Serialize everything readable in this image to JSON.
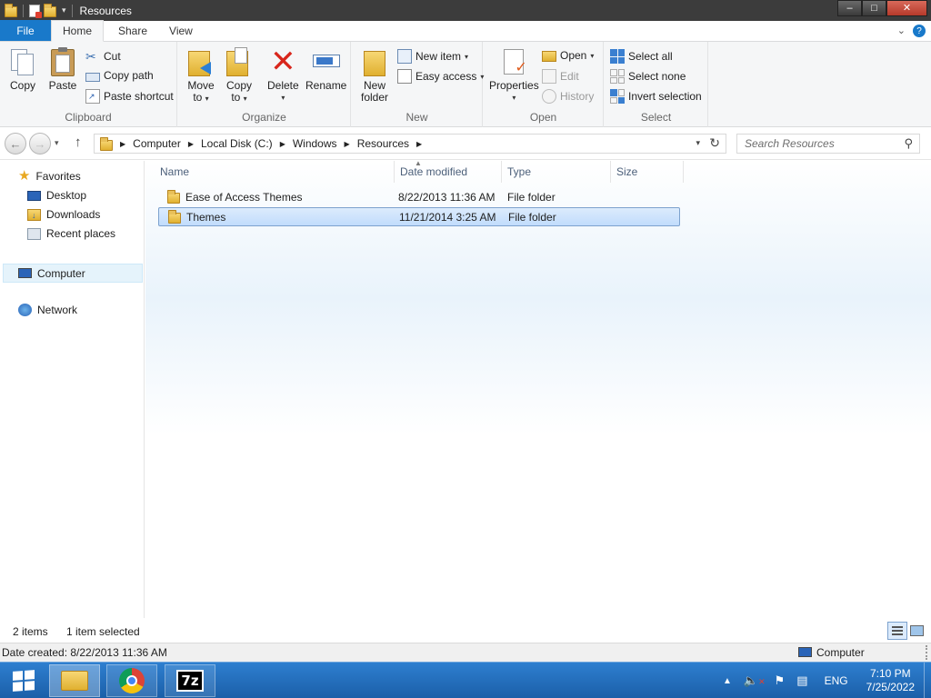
{
  "window": {
    "title": "Resources",
    "min_label": "–",
    "max_label": "□",
    "close_label": "✕"
  },
  "ribbon_tabs": {
    "file": "File",
    "home": "Home",
    "share": "Share",
    "view": "View"
  },
  "ribbon": {
    "clipboard": {
      "label": "Clipboard",
      "copy": "Copy",
      "paste": "Paste",
      "cut": "Cut",
      "copy_path": "Copy path",
      "paste_shortcut": "Paste shortcut"
    },
    "organize": {
      "label": "Organize",
      "move_to_1": "Move",
      "move_to_2": "to",
      "copy_to_1": "Copy",
      "copy_to_2": "to",
      "delete": "Delete",
      "rename": "Rename"
    },
    "new": {
      "label": "New",
      "new_folder_1": "New",
      "new_folder_2": "folder",
      "new_item": "New item",
      "easy_access": "Easy access"
    },
    "open": {
      "label": "Open",
      "properties": "Properties",
      "open": "Open",
      "edit": "Edit",
      "history": "History"
    },
    "select": {
      "label": "Select",
      "select_all": "Select all",
      "select_none": "Select none",
      "invert_selection": "Invert selection"
    }
  },
  "address": {
    "crumbs": [
      "Computer",
      "Local Disk (C:)",
      "Windows",
      "Resources"
    ],
    "search_placeholder": "Search Resources"
  },
  "nav_pane": {
    "favorites": "Favorites",
    "desktop": "Desktop",
    "downloads": "Downloads",
    "recent_places": "Recent places",
    "computer": "Computer",
    "network": "Network"
  },
  "columns": {
    "name": "Name",
    "date_modified": "Date modified",
    "type": "Type",
    "size": "Size"
  },
  "files": [
    {
      "name": "Ease of Access Themes",
      "date": "8/22/2013 11:36 AM",
      "type": "File folder",
      "size": ""
    },
    {
      "name": "Themes",
      "date": "11/21/2014 3:25 AM",
      "type": "File folder",
      "size": ""
    }
  ],
  "status": {
    "item_count": "2 items",
    "selection": "1 item selected",
    "date_created": "Date created: 8/22/2013 11:36 AM",
    "location": "Computer"
  },
  "taskbar": {
    "language": "ENG",
    "time": "7:10 PM",
    "date": "7/25/2022",
    "sevenzip_label": "7z"
  },
  "colors": {
    "file_tab": "#1979ca",
    "taskbar": "#2e7fd0",
    "selection": "#c1dcfc"
  }
}
